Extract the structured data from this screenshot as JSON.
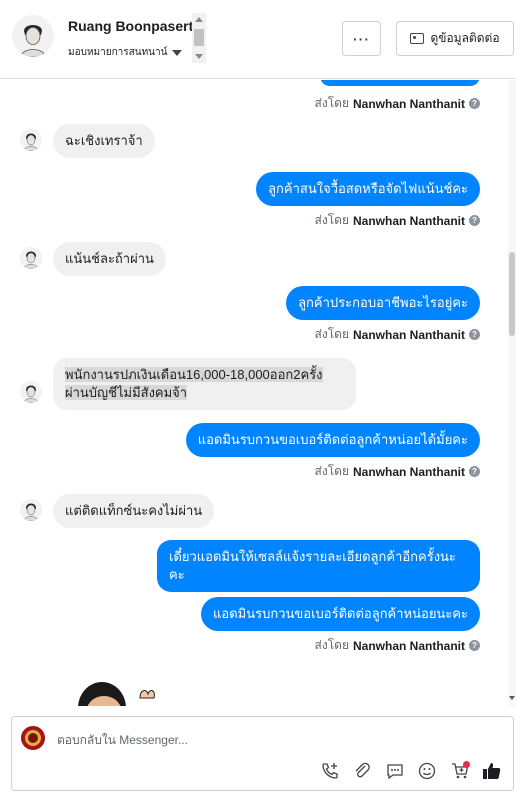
{
  "header": {
    "contact_name": "Ruang Boonpasert",
    "assign_label": "มอบหมายการสนทนาน์",
    "more_label": "···",
    "view_contact_label": "ดูข้อมูลติดต่อ"
  },
  "messages": {
    "sent_by_prefix": "ส่งโดย",
    "agent_name": "Nanwhan Nanthanit",
    "m1": "ฉะเชิงเทราจ้า",
    "m2": "ลูกค้าสนใจวื้อสดหรือจัดไฟแน้นช์คะ",
    "m3": "แน้นช์ละถ้าผ่าน",
    "m4": "ลูกค้าประกอบอาชีพอะไรอยู่คะ",
    "m5_line1": "พนักงานรปภเงินเดือน16,000-18,000ออก2ครั้ง",
    "m5_line2": "ผ่านบัญชีไม่มีสังคมจ้า",
    "m6": "แอดมินรบกวนขอเบอร์ติดต่อลูกค้าหน่อยได้มั้ยคะ",
    "m7": "แต่ติดแท็กซ์นะคงไม่ผ่าน",
    "m8_line1": "เดี๋ยวแอดมินให้เซลล์แจ้งรายละเอียดลูกค้าอีกครั้งนะ",
    "m8_line2": "คะ",
    "m9": "แอดมินรบกวนขอเบอร์ติดต่อลูกค้าหน่อยนะคะ"
  },
  "composer": {
    "placeholder": "ตอบกลับใน Messenger..."
  },
  "icons": {
    "call": "add-call-icon",
    "attach": "paperclip-icon",
    "reply": "quick-reply-icon",
    "emoji": "emoji-icon",
    "cart": "add-to-cart-icon",
    "like": "thumbs-up-icon"
  },
  "colors": {
    "outgoing_bubble": "#0084ff",
    "incoming_bubble": "#f1f0f0",
    "like_icon": "#1c1e21",
    "badge": "#f02849"
  }
}
